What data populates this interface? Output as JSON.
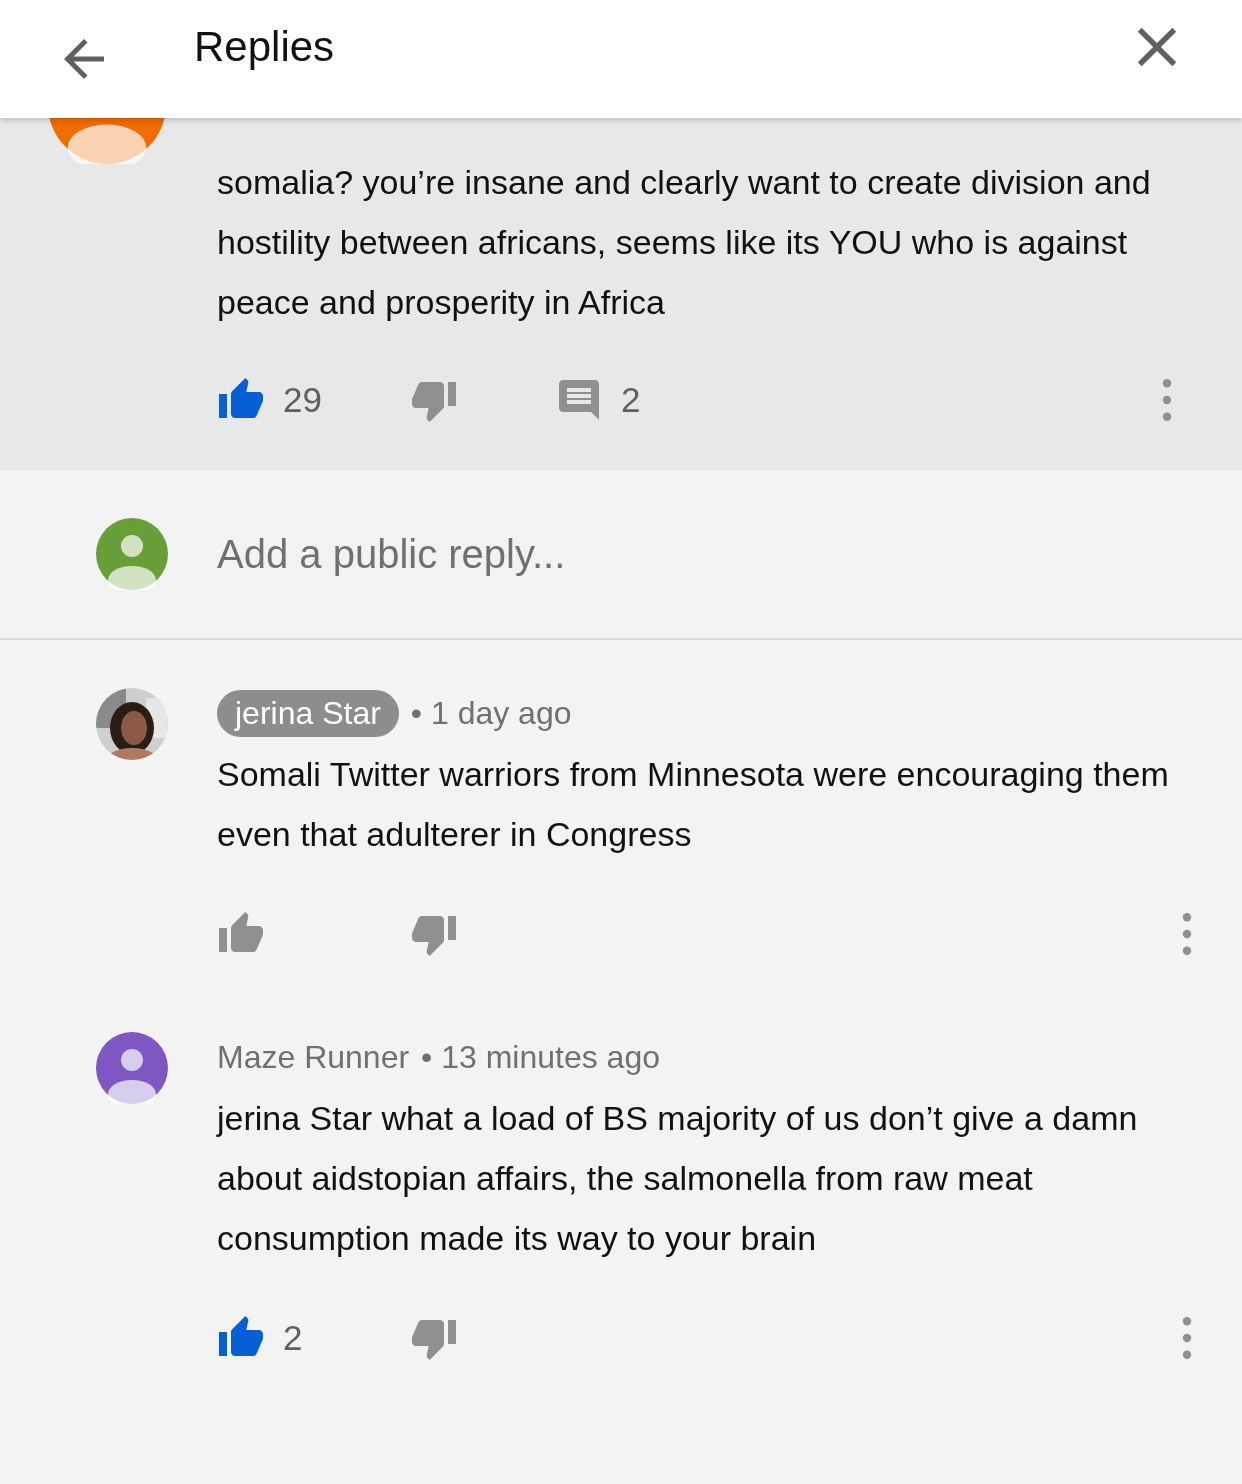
{
  "header": {
    "title": "Replies"
  },
  "comment": {
    "avatar": {
      "kind": "color",
      "color": "#ef6c00"
    },
    "text": "somalia? you’re insane and clearly want to create division and hostility between africans, seems like its YOU who is against peace and prosperity in Africa",
    "liked": true,
    "likes": "29",
    "replies": "2"
  },
  "reply_box": {
    "placeholder": "Add a public reply..."
  },
  "replies": [
    {
      "author": "jerina Star",
      "highlighted": true,
      "time": "• 1 day ago",
      "text": "Somali Twitter warriors from Minnesota were encouraging them even that adulterer in Congress",
      "liked": false
    },
    {
      "author": "Maze Runner",
      "highlighted": false,
      "time": "• 13 minutes ago",
      "avatar": {
        "kind": "color",
        "color": "#7e57c2"
      },
      "text": "jerina Star what a load of BS majority of us don’t give a damn about aidstopian affairs, the salmonella from raw meat consumption made its way to your brain",
      "liked": true,
      "likes": "2"
    }
  ]
}
